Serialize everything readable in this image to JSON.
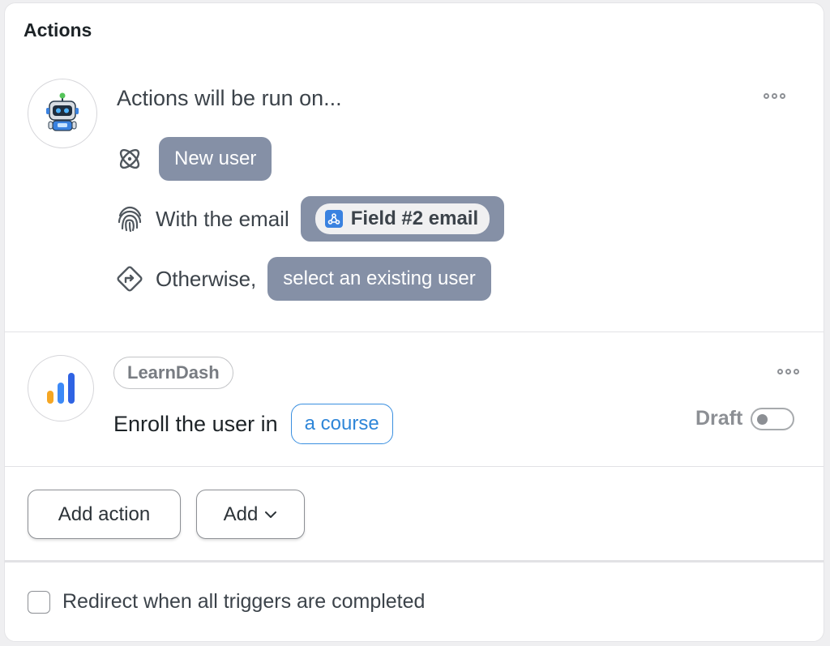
{
  "panel": {
    "title": "Actions"
  },
  "run_on": {
    "heading": "Actions will be run on...",
    "new_user_label": "New user",
    "email_prefix": "With the email",
    "email_field": "Field #2 email",
    "otherwise_prefix": "Otherwise,",
    "otherwise_value": "select an existing user"
  },
  "action": {
    "integration": "LearnDash",
    "sentence_prefix": "Enroll the user in",
    "course_token": "a course",
    "status_label": "Draft",
    "status_enabled": false
  },
  "buttons": {
    "add_action": "Add action",
    "add": "Add"
  },
  "footer": {
    "redirect_label": "Redirect when all triggers are completed",
    "redirect_checked": false
  },
  "colors": {
    "token_gray": "#8590a6",
    "accent_blue": "#2f86d8",
    "learndash_blue": "#2f63e3",
    "learndash_orange": "#f5a623"
  },
  "icons": {
    "atom": "atom-icon",
    "fingerprint": "fingerprint-icon",
    "route": "route-diamond-icon",
    "webhook": "webhook-icon",
    "more": "more-dots-icon",
    "chevron": "chevron-down-icon"
  }
}
